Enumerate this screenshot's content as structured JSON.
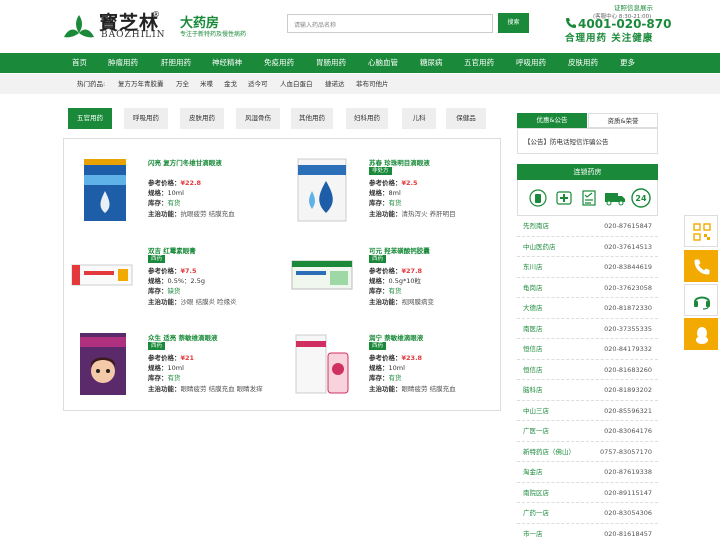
{
  "header": {
    "logo_cn": "寳芝林",
    "logo_reg": "®",
    "logo_en": "BAOZHILIN",
    "store_name": "大药房",
    "slogan": "专注于新特药及慢性病药",
    "search_placeholder": "请输入药品名称",
    "search_button": "搜索",
    "cert_link": "证照信息展示",
    "hours": "(客服中心 8:30-21:00)",
    "phone": "4001-020-870",
    "phone_slogan": "合理用药 关注健康"
  },
  "nav": [
    "首页",
    "肿瘤用药",
    "肝胆用药",
    "神经精神",
    "免疫用药",
    "胃肠用药",
    "心脑血管",
    "糖尿病",
    "五官用药",
    "呼吸用药",
    "皮肤用药",
    "更多"
  ],
  "hot": {
    "label": "热门药品:",
    "items": [
      "复方万年青胶囊",
      "万全",
      "米喋",
      "金戈",
      "适今可",
      "人血白蛋白",
      "捷诺达",
      "菲布司他片"
    ]
  },
  "tabs": [
    "五官用药",
    "呼吸用药",
    "皮肤用药",
    "风湿骨伤",
    "其他用药",
    "妇科用药",
    "儿科",
    "保健品"
  ],
  "product_labels": {
    "price": "参考价格：",
    "spec": "规格：",
    "stock": "库存：",
    "indication": "主治功能："
  },
  "products": [
    {
      "name": "闪亮 复方门冬维甘滴眼液",
      "rx": "",
      "price": "¥22.8",
      "spec": "10ml",
      "stock": "有货",
      "indication": "抗眼疲劳 结膜充血"
    },
    {
      "name": "苏春 珍珠明目滴眼液",
      "rx": "非处方",
      "price": "¥2.5",
      "spec": "8ml",
      "stock": "有货",
      "indication": "清热泻火 养肝明目"
    },
    {
      "name": "双吉 红霉素眼膏",
      "rx": "西药",
      "price": "¥7.5",
      "spec": "0.5%：2.5g",
      "stock": "缺货",
      "indication": "沙眼 结膜炎 睑缘炎"
    },
    {
      "name": "可元 羟苯磺酸钙胶囊",
      "rx": "西药",
      "price": "¥27.8",
      "spec": "0.5g*10粒",
      "stock": "有货",
      "indication": "视网膜病变"
    },
    {
      "name": "众生 适亮 萘敏维滴眼液",
      "rx": "西药",
      "price": "¥21",
      "spec": "10ml",
      "stock": "有货",
      "indication": "眼睛疲劳 结膜充血 眼睛发痒"
    },
    {
      "name": "润宁 萘敏维滴眼液",
      "rx": "西药",
      "price": "¥23.8",
      "spec": "10ml",
      "stock": "有货",
      "indication": "眼睛疲劳 结膜充血"
    }
  ],
  "sidebar": {
    "tab_active": "优惠&公告",
    "tab_inactive": "资质&荣誉",
    "notice": "【公告】防电话短信诈骗公告",
    "chain_title": "连锁药房",
    "icons": [
      "medicine-bottle-icon",
      "medical-cross-icon",
      "checklist-icon",
      "delivery-truck-icon",
      "24-hours-icon"
    ],
    "stores": [
      {
        "name": "先烈南店",
        "tel": "020-87615847"
      },
      {
        "name": "中山医药店",
        "tel": "020-37614513"
      },
      {
        "name": "东川店",
        "tel": "020-83844619"
      },
      {
        "name": "龟岗店",
        "tel": "020-37623058"
      },
      {
        "name": "大德店",
        "tel": "020-81872330"
      },
      {
        "name": "南医店",
        "tel": "020-37355335"
      },
      {
        "name": "恒信店",
        "tel": "020-84179332"
      },
      {
        "name": "恒信店",
        "tel": "020-81683260"
      },
      {
        "name": "脑科店",
        "tel": "020-81893202"
      },
      {
        "name": "中山三店",
        "tel": "020-85596321"
      },
      {
        "name": "广医一店",
        "tel": "020-83064176"
      },
      {
        "name": "新特药店（佛山）",
        "tel": "0757-83057170"
      },
      {
        "name": "淘金店",
        "tel": "020-87619338"
      },
      {
        "name": "南院区店",
        "tel": "020-89115147"
      },
      {
        "name": "广药一店",
        "tel": "020-83054306"
      },
      {
        "name": "市一店",
        "tel": "020-81618457"
      }
    ]
  },
  "colors": {
    "brand": "#1a8a3a",
    "price": "#e4393c",
    "accent": "#f2a900"
  }
}
